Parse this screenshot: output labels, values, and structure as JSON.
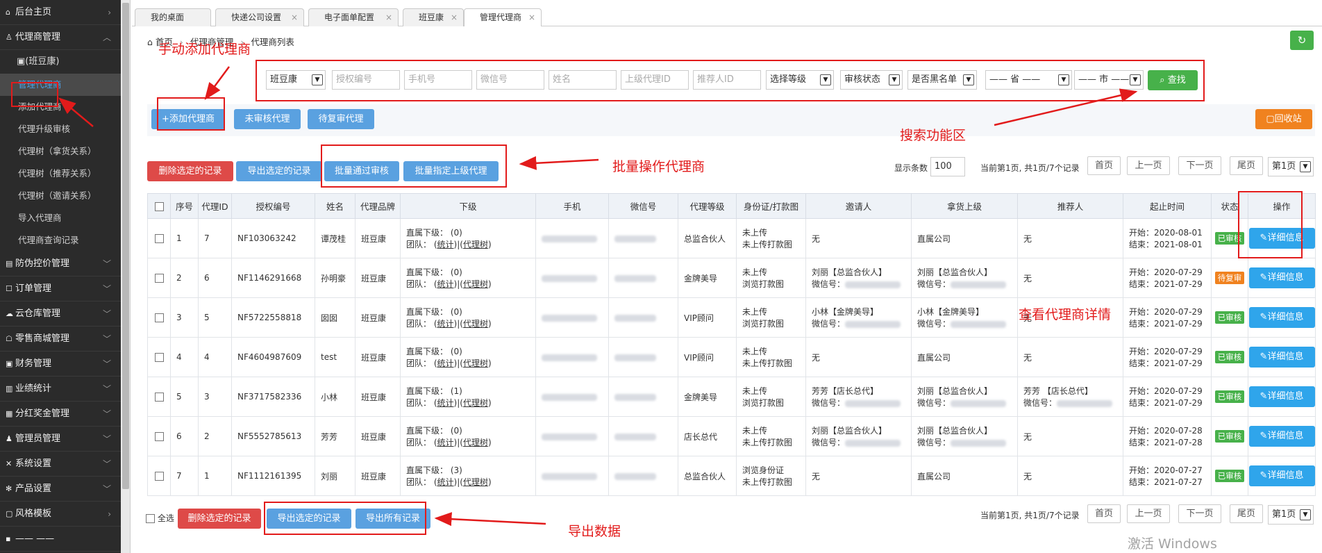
{
  "sidebar": {
    "items_top": [
      {
        "label": "后台主页",
        "icon": "home-icon"
      },
      {
        "label": "代理商管理",
        "icon": "user-icon"
      }
    ],
    "sub_head": "(班豆康)",
    "sub_items": [
      "管理代理商",
      "添加代理商",
      "代理升级审核",
      "代理树（拿货关系）",
      "代理树（推荐关系）",
      "代理树（邀请关系）",
      "导入代理商",
      "代理商查询记录"
    ],
    "items_bottom": [
      "防伪控价管理",
      "订单管理",
      "云仓库管理",
      "零售商城管理",
      "财务管理",
      "业绩统计",
      "分红奖金管理",
      "管理员管理",
      "系统设置",
      "产品设置",
      "风格模板",
      "—— ——"
    ]
  },
  "tabs": [
    "我的桌面",
    "快递公司设置",
    "电子面单配置",
    "班豆康",
    "管理代理商"
  ],
  "breadcrumb": {
    "home": "首页",
    "level1": "代理商管理",
    "level2": "代理商列表"
  },
  "filters": {
    "brand": "班豆康",
    "auth_no": "授权编号",
    "phone": "手机号",
    "wechat": "微信号",
    "name": "姓名",
    "parent_id": "上级代理ID",
    "referrer_id": "推荐人ID",
    "level": "选择等级",
    "review": "审核状态",
    "blacklist": "是否黑名单",
    "province": "—— 省 ——",
    "city": "—— 市 ——",
    "search": "查找"
  },
  "toolbar": {
    "add": "+添加代理商",
    "unreviewed": "未审核代理",
    "pending": "待复审代理",
    "recycle": "回收站"
  },
  "batch": {
    "delete": "删除选定的记录",
    "export": "导出选定的记录",
    "approve": "批量通过审核",
    "assign_parent": "批量指定上级代理"
  },
  "pager": {
    "show_label": "显示条数",
    "show_count": "100",
    "info": "当前第1页, 共1页/7个记录",
    "first": "首页",
    "prev": "上一页",
    "next": "下一页",
    "last": "尾页",
    "page": "第1页"
  },
  "columns": [
    "",
    "序号",
    "代理ID",
    "授权编号",
    "姓名",
    "代理品牌",
    "下级",
    "手机",
    "微信号",
    "代理等级",
    "身份证/打款图",
    "邀请人",
    "拿货上级",
    "推荐人",
    "起止时间",
    "状态",
    "操作"
  ],
  "rows": [
    {
      "no": "1",
      "id": "7",
      "auth": "NF103063242",
      "name": "谭茂桂",
      "brand": "班豆康",
      "sub": "(0)",
      "level": "总监合伙人",
      "id_doc": [
        "未上传",
        "未上传打款图"
      ],
      "inviter": "无",
      "inviter_wx": false,
      "parent": "直属公司",
      "parent_wx": false,
      "referrer": "无",
      "referrer_wx": false,
      "start": "开始：2020-08-01",
      "end": "结束：2021-08-01",
      "status": "已审核"
    },
    {
      "no": "2",
      "id": "6",
      "auth": "NF1146291668",
      "name": "孙明豪",
      "brand": "班豆康",
      "sub": "(0)",
      "level": "金牌美导",
      "id_doc": [
        "未上传",
        "浏览打款图"
      ],
      "inviter": "刘丽【总监合伙人】",
      "inviter_wx": true,
      "parent": "刘丽【总监合伙人】",
      "parent_wx": true,
      "referrer": "无",
      "referrer_wx": false,
      "start": "开始：2020-07-29",
      "end": "结束：2021-07-29",
      "status": "待复审"
    },
    {
      "no": "3",
      "id": "5",
      "auth": "NF5722558818",
      "name": "囡囡",
      "brand": "班豆康",
      "sub": "(0)",
      "level": "VIP顾问",
      "id_doc": [
        "未上传",
        "浏览打款图"
      ],
      "inviter": "小林【金牌美导】",
      "inviter_wx": true,
      "parent": "小林【金牌美导】",
      "parent_wx": true,
      "referrer": "无",
      "referrer_wx": false,
      "start": "开始：2020-07-29",
      "end": "结束：2021-07-29",
      "status": "已审核"
    },
    {
      "no": "4",
      "id": "4",
      "auth": "NF4604987609",
      "name": "test",
      "brand": "班豆康",
      "sub": "(0)",
      "level": "VIP顾问",
      "id_doc": [
        "未上传",
        "未上传打款图"
      ],
      "inviter": "无",
      "inviter_wx": false,
      "parent": "直属公司",
      "parent_wx": false,
      "referrer": "无",
      "referrer_wx": false,
      "start": "开始：2020-07-29",
      "end": "结束：2021-07-29",
      "status": "已审核"
    },
    {
      "no": "5",
      "id": "3",
      "auth": "NF3717582336",
      "name": "小林",
      "brand": "班豆康",
      "sub": "(1)",
      "level": "金牌美导",
      "id_doc": [
        "未上传",
        "浏览打款图"
      ],
      "inviter": "芳芳【店长总代】",
      "inviter_wx": true,
      "parent": "刘丽【总监合伙人】",
      "parent_wx": true,
      "referrer": "芳芳 【店长总代】",
      "referrer_wx": true,
      "start": "开始：2020-07-29",
      "end": "结束：2021-07-29",
      "status": "已审核"
    },
    {
      "no": "6",
      "id": "2",
      "auth": "NF5552785613",
      "name": "芳芳",
      "brand": "班豆康",
      "sub": "(0)",
      "level": "店长总代",
      "id_doc": [
        "未上传",
        "未上传打款图"
      ],
      "inviter": "刘丽【总监合伙人】",
      "inviter_wx": true,
      "parent": "刘丽【总监合伙人】",
      "parent_wx": true,
      "referrer": "无",
      "referrer_wx": false,
      "start": "开始：2020-07-28",
      "end": "结束：2021-07-28",
      "status": "已审核"
    },
    {
      "no": "7",
      "id": "1",
      "auth": "NF1112161395",
      "name": "刘丽",
      "brand": "班豆康",
      "sub": "(3)",
      "level": "总监合伙人",
      "id_doc": [
        "浏览身份证",
        "未上传打款图"
      ],
      "inviter": "无",
      "inviter_wx": false,
      "parent": "直属公司",
      "parent_wx": false,
      "referrer": "无",
      "referrer_wx": false,
      "start": "开始：2020-07-27",
      "end": "结束：2021-07-27",
      "status": "已审核"
    }
  ],
  "cell_labels": {
    "direct": "直属下级：",
    "team": "团队：",
    "stat": "统计",
    "tree": "代理树",
    "wx": "微信号：",
    "detail": "详细信息"
  },
  "bottom": {
    "select_all": "全选",
    "delete": "删除选定的记录",
    "export_selected": "导出选定的记录",
    "export_all": "导出所有记录"
  },
  "annotations": {
    "add": "手动添加代理商",
    "search": "搜索功能区",
    "batch": "批量操作代理商",
    "detail": "查看代理商详情",
    "export": "导出数据"
  },
  "watermark": "激活 Windows",
  "colors": {
    "accent": "#2fa5eb",
    "green": "#47b14a",
    "red": "#de4a48",
    "orange": "#f0821f",
    "annotation": "#e21b1b"
  }
}
